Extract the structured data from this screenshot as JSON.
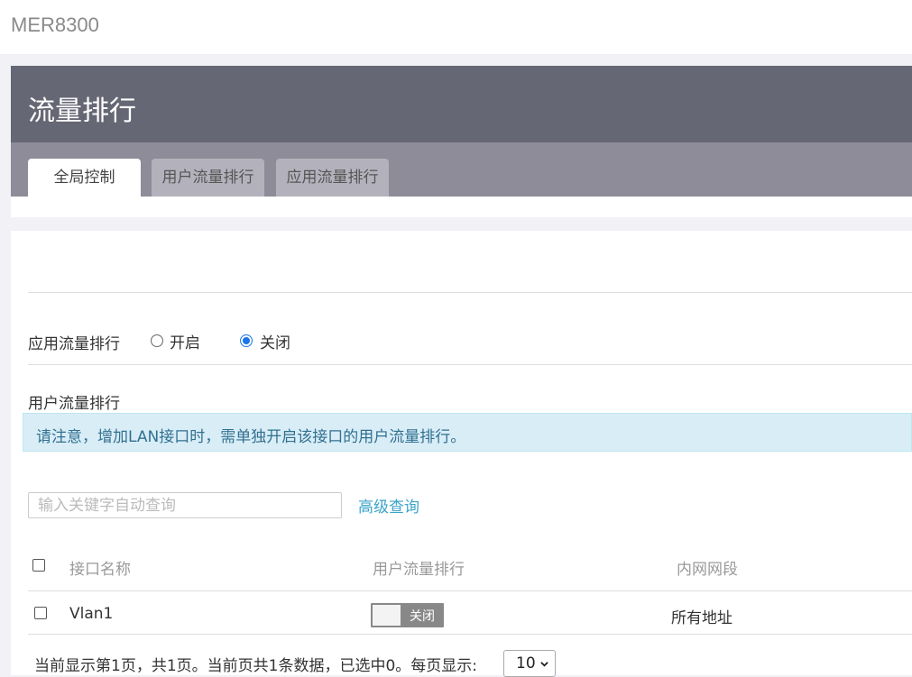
{
  "app": {
    "brand": "MER8300"
  },
  "page": {
    "title": "流量排行"
  },
  "tabs": [
    {
      "label": "全局控制",
      "active": true
    },
    {
      "label": "用户流量排行",
      "active": false
    },
    {
      "label": "应用流量排行",
      "active": false
    }
  ],
  "app_ranking": {
    "label": "应用流量排行",
    "options": [
      {
        "label": "开启",
        "checked": false
      },
      {
        "label": "关闭",
        "checked": true
      }
    ]
  },
  "user_ranking": {
    "label": "用户流量排行",
    "notice": "请注意，增加LAN接口时，需单独开启该接口的用户流量排行。"
  },
  "search": {
    "placeholder": "输入关键字自动查询",
    "value": "",
    "advanced_label": "高级查询"
  },
  "table": {
    "headers": [
      "接口名称",
      "用户流量排行",
      "内网网段"
    ],
    "rows": [
      {
        "name": "Vlan1",
        "switch_label": "关闭",
        "switch_on": false,
        "segment": "所有地址"
      }
    ]
  },
  "pagination": {
    "summary": "当前显示第1页，共1页。当前页共1条数据，已选中0。每页显示:",
    "page_size": "10"
  },
  "colors": {
    "header_bg": "#666774",
    "tabbar_bg": "#8d8c98",
    "notice_bg": "#d9edf7",
    "link": "#3aa4c8",
    "radio_accent": "#1a73e8"
  }
}
